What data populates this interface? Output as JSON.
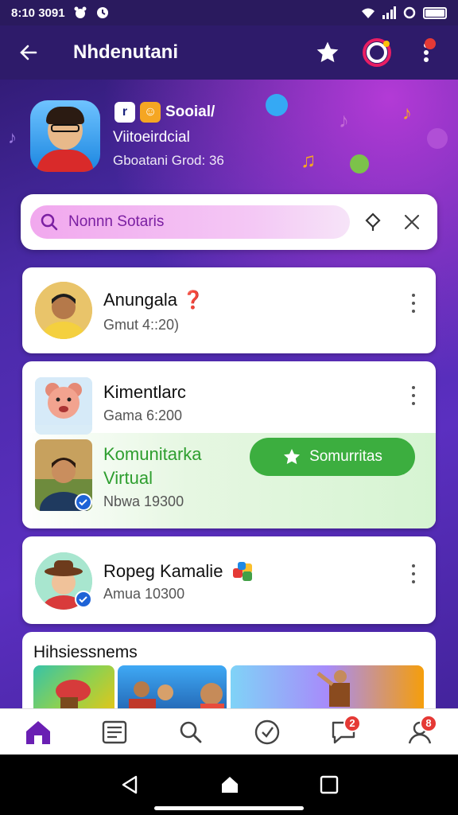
{
  "status_bar": {
    "time": "8:10 3091"
  },
  "app_bar": {
    "title": "Nhdenutani"
  },
  "profile": {
    "tag_icon_1": "r",
    "tag_icon_2": "☺",
    "platform": "Sooial/",
    "line2": "Viitoeirdcial",
    "line3": "Gboatani Grod: 36"
  },
  "search": {
    "value": "Nonnn Sotaris"
  },
  "contacts": [
    {
      "name": "Anungala",
      "sub": "Gmut 4::20)"
    },
    {
      "name": "Kimentlarc",
      "sub": "Gama 6:200"
    },
    {
      "name_line1": "Komunitarka",
      "name_line2": "Virtual",
      "sub": "Nbwa 19300",
      "action": "Somurritas"
    },
    {
      "name": "Ropeg Kamalie",
      "sub": "Amua 10300"
    }
  ],
  "highlights": {
    "title": "Hihsiessnems"
  },
  "bottom_nav": {
    "chat_badge": "2",
    "profile_badge": "8"
  },
  "colors": {
    "accent": "#7b1fa2",
    "green": "#3cae3f",
    "appbar": "#2e1b6a",
    "badge": "#e53935"
  }
}
